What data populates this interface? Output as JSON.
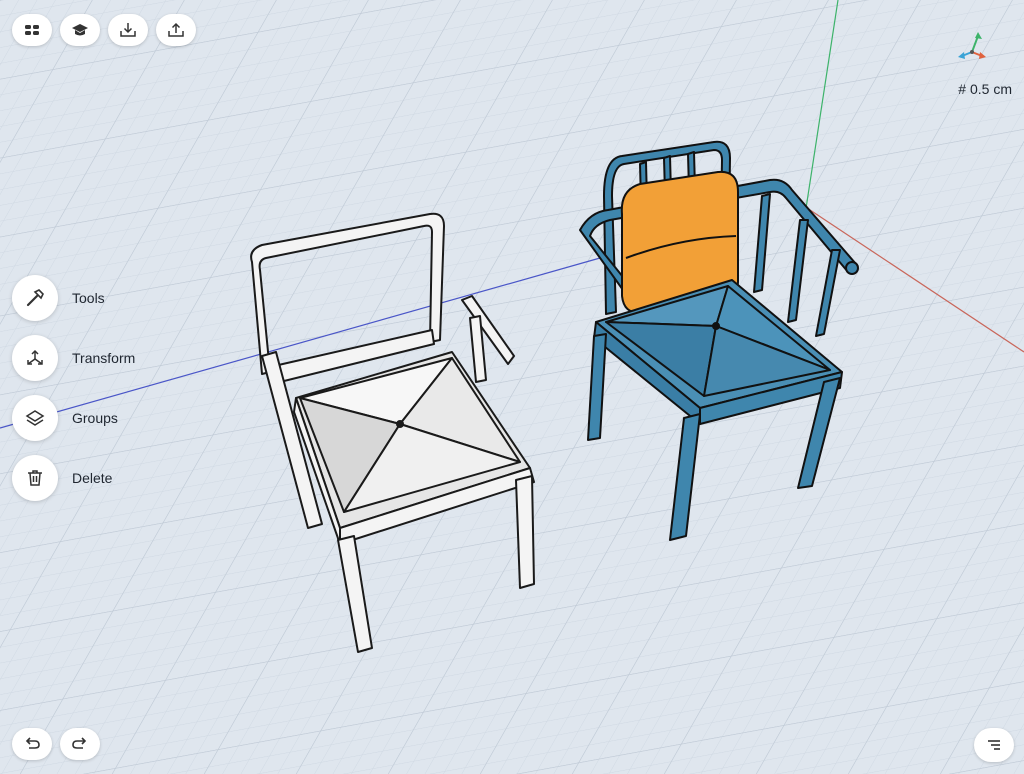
{
  "toolbar": {
    "items": [
      {
        "name": "apps-menu-button",
        "icon": "grid-icon"
      },
      {
        "name": "learn-button",
        "icon": "graduation-cap-icon"
      },
      {
        "name": "import-button",
        "icon": "download-tray-icon"
      },
      {
        "name": "export-button",
        "icon": "share-upload-icon"
      }
    ]
  },
  "sidebar": {
    "items": [
      {
        "label": "Tools",
        "icon": "hammer-icon"
      },
      {
        "label": "Transform",
        "icon": "transform-arrows-icon"
      },
      {
        "label": "Groups",
        "icon": "layers-icon"
      },
      {
        "label": "Delete",
        "icon": "trash-icon"
      }
    ]
  },
  "view": {
    "grid_size_label": "0.5 cm",
    "grid_icon": "#"
  },
  "history": {
    "undo_icon": "undo-icon",
    "redo_icon": "redo-icon"
  },
  "colors": {
    "background": "#dfe6ee",
    "grid_minor": "#cdd6e0",
    "grid_major": "#bcc7d3",
    "axis_red": "#c9665a",
    "axis_green": "#3db36a",
    "axis_blue": "#4a56c8",
    "chair_white": "#f4f4f4",
    "chair_blue": "#3f86ad",
    "cushion_orange": "#f2a037",
    "outline": "#1a1a1a"
  }
}
